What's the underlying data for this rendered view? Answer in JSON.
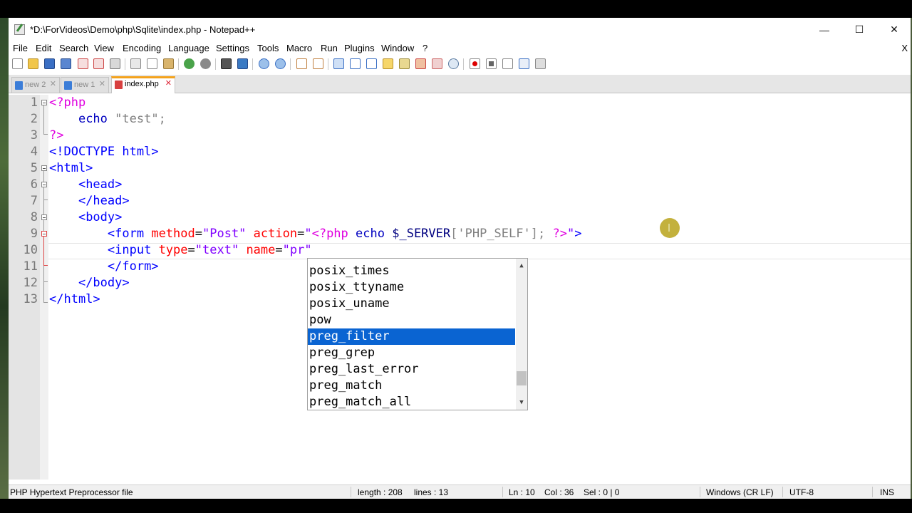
{
  "window": {
    "title": "*D:\\ForVideos\\Demo\\php\\Sqlite\\index.php - Notepad++",
    "minimize": "—",
    "maximize": "☐",
    "close": "✕"
  },
  "menu": {
    "items": [
      "File",
      "Edit",
      "Search",
      "View",
      "Encoding",
      "Language",
      "Settings",
      "Tools",
      "Macro",
      "Run",
      "Plugins",
      "Window",
      "?"
    ],
    "close_label": "X"
  },
  "toolbar": {
    "icons": [
      "new-file-icon",
      "open-file-icon",
      "save-icon",
      "save-all-icon",
      "close-file-icon",
      "close-all-icon",
      "print-icon",
      "cut-icon",
      "copy-icon",
      "paste-icon",
      "undo-icon",
      "redo-icon",
      "find-icon",
      "replace-icon",
      "zoom-in-icon",
      "zoom-out-icon",
      "sync-vertical-icon",
      "sync-horizontal-icon",
      "word-wrap-icon",
      "show-all-chars-icon",
      "indent-guide-icon",
      "doc-map-icon",
      "function-list-icon",
      "folder-workspace-icon",
      "doc-switcher-icon",
      "monitor-icon",
      "record-macro-icon",
      "stop-macro-icon",
      "play-macro-icon",
      "run-macro-multiple-icon",
      "save-macro-icon"
    ]
  },
  "tabs": [
    {
      "label": "new 2",
      "active": false
    },
    {
      "label": "new 1",
      "active": false
    },
    {
      "label": "index.php",
      "active": true
    }
  ],
  "editor": {
    "line_numbers": [
      "1",
      "2",
      "3",
      "4",
      "5",
      "6",
      "7",
      "8",
      "9",
      "10",
      "11",
      "12",
      "13"
    ],
    "lines": [
      {
        "parts": [
          {
            "t": "<?php",
            "c": "php-tag"
          }
        ]
      },
      {
        "parts": [
          {
            "t": "    ",
            "c": ""
          },
          {
            "t": "echo",
            "c": "php-kw"
          },
          {
            "t": " ",
            "c": ""
          },
          {
            "t": "\"test\"",
            "c": "php-str"
          },
          {
            "t": ";",
            "c": "punct"
          }
        ]
      },
      {
        "parts": [
          {
            "t": "?>",
            "c": "php-tag"
          }
        ]
      },
      {
        "parts": [
          {
            "t": "<!DOCTYPE html>",
            "c": "h-tag"
          }
        ]
      },
      {
        "parts": [
          {
            "t": "<html>",
            "c": "h-tag"
          }
        ]
      },
      {
        "parts": [
          {
            "t": "    ",
            "c": ""
          },
          {
            "t": "<head>",
            "c": "h-tag"
          }
        ]
      },
      {
        "parts": [
          {
            "t": "    ",
            "c": ""
          },
          {
            "t": "</head>",
            "c": "h-tag"
          }
        ]
      },
      {
        "parts": [
          {
            "t": "    ",
            "c": ""
          },
          {
            "t": "<body>",
            "c": "h-tag"
          }
        ]
      },
      {
        "parts": [
          {
            "t": "        ",
            "c": ""
          },
          {
            "t": "<form",
            "c": "h-tag"
          },
          {
            "t": " ",
            "c": ""
          },
          {
            "t": "method",
            "c": "h-attr"
          },
          {
            "t": "=",
            "c": "h-eq"
          },
          {
            "t": "\"Post\"",
            "c": "h-val"
          },
          {
            "t": " ",
            "c": ""
          },
          {
            "t": "action",
            "c": "h-attr"
          },
          {
            "t": "=",
            "c": "h-eq"
          },
          {
            "t": "\"",
            "c": "h-val"
          },
          {
            "t": "<?php",
            "c": "php-tag"
          },
          {
            "t": " ",
            "c": ""
          },
          {
            "t": "echo",
            "c": "php-kw"
          },
          {
            "t": " ",
            "c": ""
          },
          {
            "t": "$_SERVER",
            "c": "php-var"
          },
          {
            "t": "[",
            "c": "punct"
          },
          {
            "t": "'PHP_SELF'",
            "c": "php-str"
          },
          {
            "t": "]",
            "c": "punct"
          },
          {
            "t": ";",
            "c": "punct"
          },
          {
            "t": " ",
            "c": ""
          },
          {
            "t": "?>",
            "c": "php-tag"
          },
          {
            "t": "\"",
            "c": "h-val"
          },
          {
            "t": ">",
            "c": "h-tag"
          }
        ]
      },
      {
        "parts": [
          {
            "t": "        ",
            "c": ""
          },
          {
            "t": "<input",
            "c": "h-tag"
          },
          {
            "t": " ",
            "c": ""
          },
          {
            "t": "type",
            "c": "h-attr"
          },
          {
            "t": "=",
            "c": "h-eq"
          },
          {
            "t": "\"text\"",
            "c": "h-val"
          },
          {
            "t": " ",
            "c": ""
          },
          {
            "t": "name",
            "c": "h-attr"
          },
          {
            "t": "=",
            "c": "h-eq"
          },
          {
            "t": "\"pr\"",
            "c": "h-val"
          }
        ]
      },
      {
        "parts": [
          {
            "t": "        ",
            "c": ""
          },
          {
            "t": "</form>",
            "c": "h-tag"
          }
        ]
      },
      {
        "parts": [
          {
            "t": "    ",
            "c": ""
          },
          {
            "t": "</body>",
            "c": "h-tag"
          }
        ]
      },
      {
        "parts": [
          {
            "t": "</html>",
            "c": "h-tag"
          }
        ]
      }
    ]
  },
  "autocomplete": {
    "items": [
      "posix_times",
      "posix_ttyname",
      "posix_uname",
      "pow",
      "preg_filter",
      "preg_grep",
      "preg_last_error",
      "preg_match",
      "preg_match_all"
    ],
    "selected_index": 4,
    "scroll_up": "▲",
    "scroll_down": "▼"
  },
  "status": {
    "file_type": "PHP Hypertext Preprocessor file",
    "length": "length : 208",
    "lines": "lines : 13",
    "ln": "Ln : 10",
    "col": "Col : 36",
    "sel": "Sel : 0 | 0",
    "eol": "Windows (CR LF)",
    "encoding": "UTF-8",
    "mode": "INS"
  },
  "colors": {
    "php_tag": "#e000e0",
    "html_tag": "#0000ff",
    "html_attr": "#ff0000",
    "html_value": "#8000ff",
    "selection": "#0a64d2",
    "active_tab_accent": "#f4a21b"
  }
}
